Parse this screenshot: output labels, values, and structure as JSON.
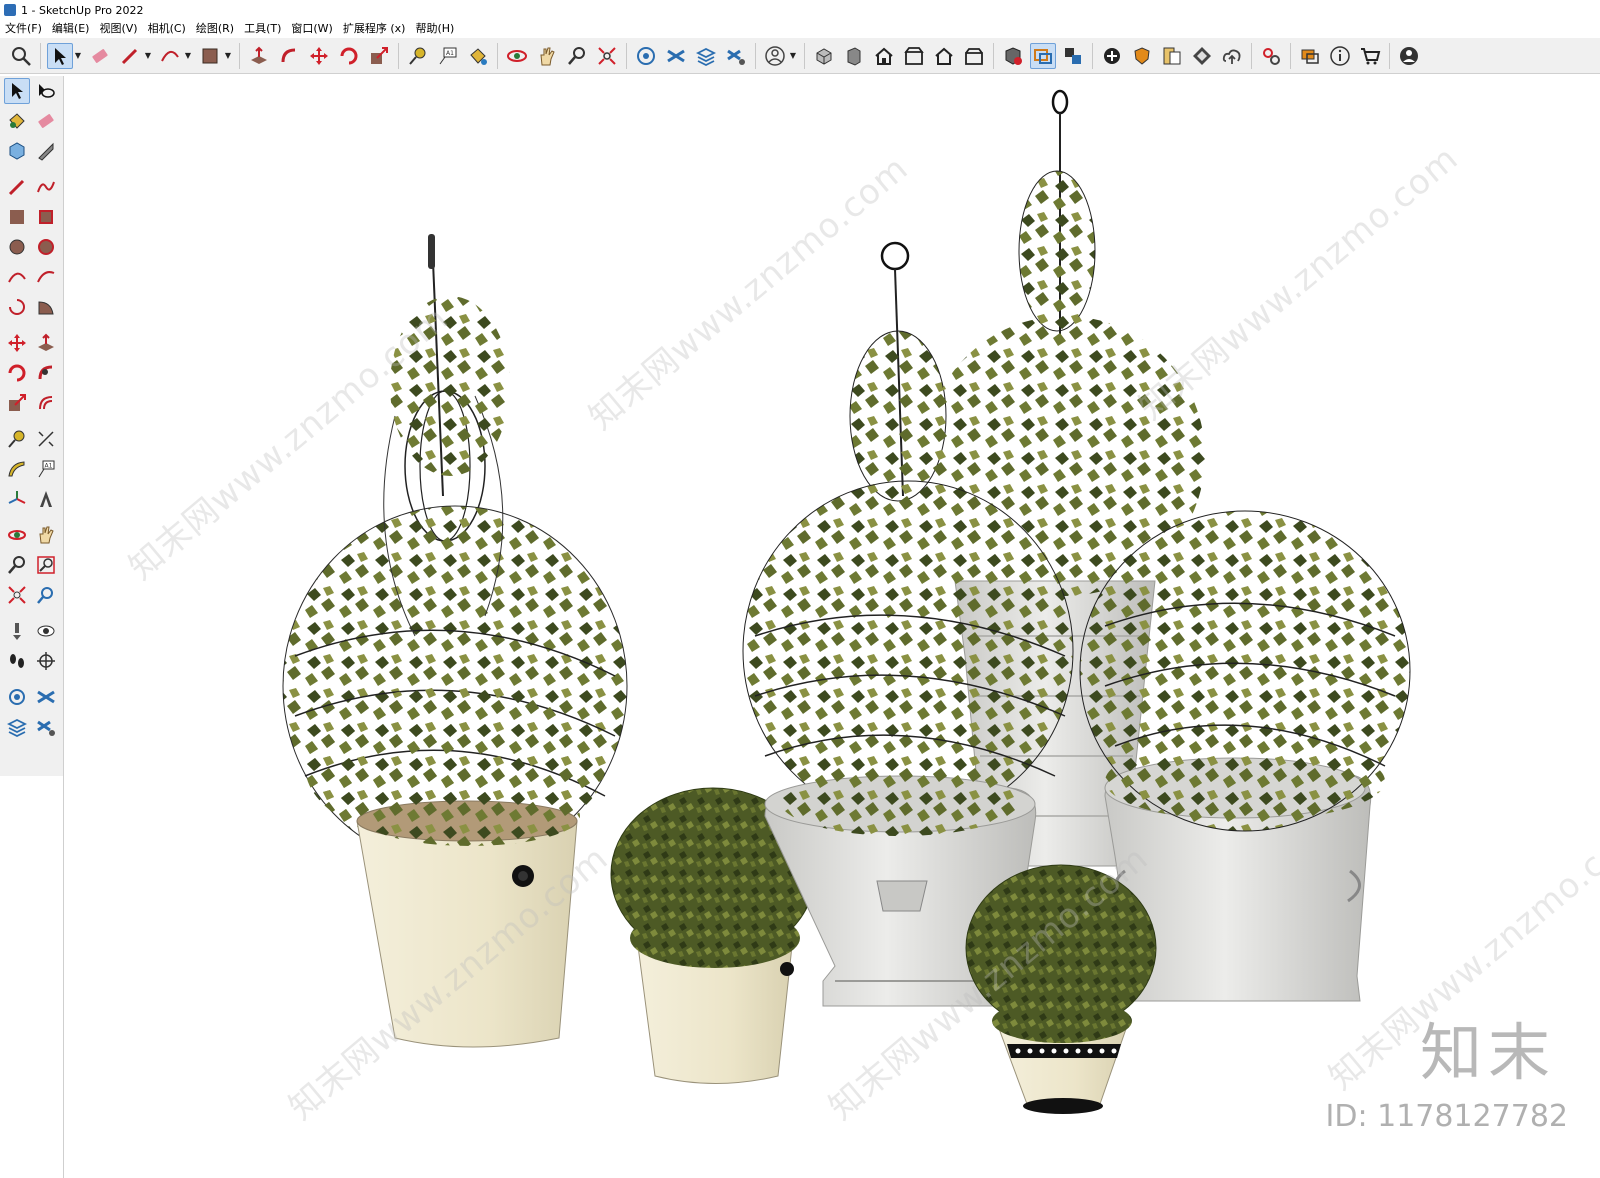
{
  "window": {
    "title": "1 - SketchUp Pro 2022"
  },
  "menu": [
    "文件(F)",
    "编辑(E)",
    "视图(V)",
    "相机(C)",
    "绘图(R)",
    "工具(T)",
    "窗口(W)",
    "扩展程序 (x)",
    "帮助(H)"
  ],
  "toolbar_icons": [
    "zoom-icon",
    "select-icon",
    "eraser-icon",
    "pencil-icon",
    "arc-icon",
    "rectangle-icon",
    "push-pull-icon",
    "follow-me-icon",
    "move-icon",
    "rotate-icon",
    "scale-icon",
    "tape-measure-icon",
    "text-icon",
    "paint-bucket-icon",
    "orbit-icon",
    "pan-icon",
    "zoom-tool-icon",
    "zoom-extents-icon",
    "3d-warehouse-icon",
    "extension-warehouse-icon",
    "layout-icon",
    "extension-manager-icon",
    "account-icon",
    "iso-view-icon",
    "top-view-icon",
    "front-view-icon",
    "right-view-icon",
    "back-view-icon",
    "left-view-icon",
    "solid-inspector-icon",
    "section-plane-icon",
    "camera-tools-icon",
    "add-location-icon",
    "shield-icon",
    "styles-icon",
    "texture-icon",
    "upload-icon",
    "settings-gear-icon",
    "components-icon",
    "info-icon",
    "cart-icon",
    "profile-icon"
  ],
  "viewport": {
    "watermark": "知末网www.znzmo.com",
    "brand": "知末",
    "image_id": "ID: 1178127782"
  },
  "colors": {
    "leaf_dark": "#3d4a1f",
    "leaf_mid": "#5f6b2c",
    "leaf_light": "#8a9143",
    "cream_pot": "#efe9d2",
    "stone_pot": "#d9d9d6",
    "toolbar_bg": "#f0f0f0",
    "active_blue": "#c9def5"
  }
}
